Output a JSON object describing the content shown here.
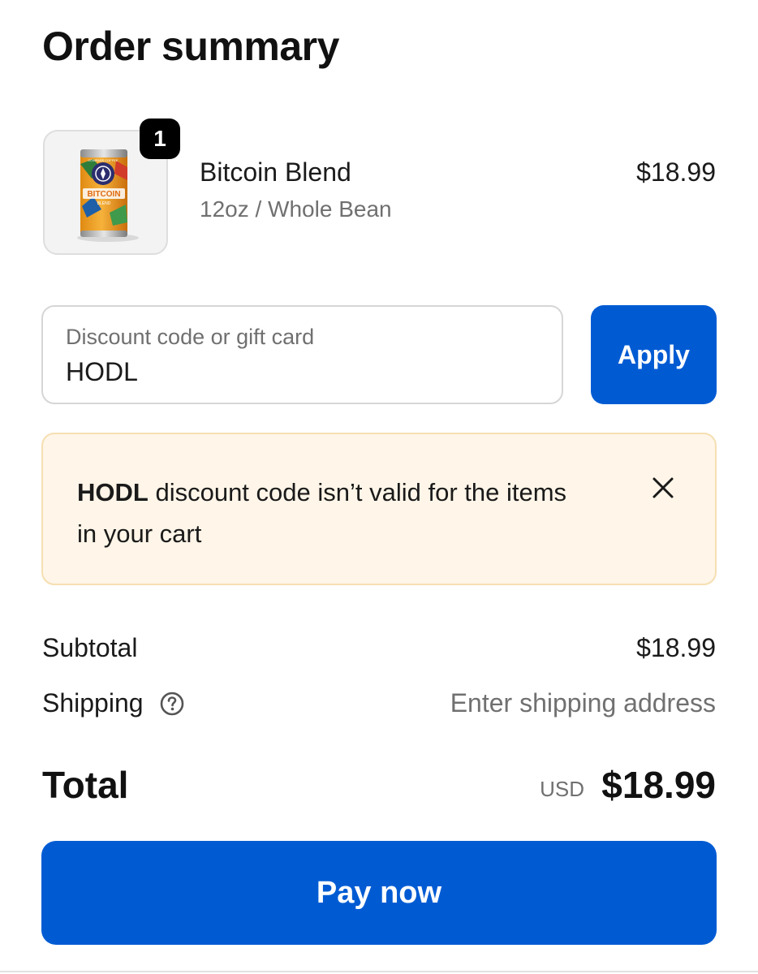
{
  "heading": "Order summary",
  "item": {
    "quantity": "1",
    "name": "Bitcoin Blend",
    "variant": "12oz / Whole Bean",
    "price": "$18.99",
    "can_brand": "COMPASS COFFEE",
    "can_title": "BITCOIN",
    "can_subtitle": "BLEND"
  },
  "discount": {
    "label": "Discount code or gift card",
    "value": "HODL",
    "apply_label": "Apply"
  },
  "notice": {
    "code": "HODL",
    "message": "discount code isn’t valid for the items in your cart"
  },
  "summary": {
    "subtotal_label": "Subtotal",
    "subtotal_value": "$18.99",
    "shipping_label": "Shipping",
    "shipping_value": "Enter shipping address",
    "total_label": "Total",
    "currency": "USD",
    "total_value": "$18.99"
  },
  "pay_label": "Pay now",
  "colors": {
    "primary": "#005bd3",
    "notice_bg": "#fff5e8",
    "notice_border": "#f5dfb2",
    "muted_text": "#707070"
  },
  "icons": [
    "close-icon",
    "help-circle-icon"
  ]
}
